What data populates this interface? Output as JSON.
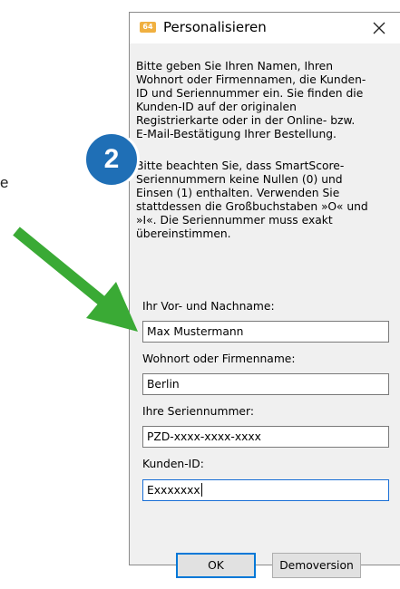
{
  "background_text": "e",
  "dialog": {
    "app_icon_label": "64",
    "title": "Personalisieren",
    "close_symbol": "✕",
    "paragraph1": "Bitte geben Sie Ihren Namen, Ihren\nWohnort oder Firmennamen, die Kunden-\nID und Seriennummer ein. Sie finden die\nKunden-ID auf der originalen\nRegistrierkarte oder in der Online- bzw.\nE-Mail-Bestätigung Ihrer Bestellung.",
    "paragraph2": "Bitte beachten Sie, dass SmartScore-\nSeriennummern keine Nullen (0) und\nEinsen (1) enthalten. Verwenden Sie\nstattdessen die Großbuchstaben »O« und\n»I«. Die Seriennummer muss exakt\nübereinstimmen.",
    "fields": {
      "name_label": "Ihr Vor- und Nachname:",
      "name_value": "Max Mustermann",
      "ort_label": "Wohnort oder Firmenname:",
      "ort_value": "Berlin",
      "serial_label": "Ihre Seriennummer:",
      "serial_value": "PZD-xxxx-xxxx-xxxx",
      "kunden_label": "Kunden-ID:",
      "kunden_value": "Exxxxxxx"
    },
    "buttons": {
      "ok": "OK",
      "demo": "Demoversion"
    }
  },
  "annotation": {
    "step_number": "2",
    "badge_color": "#1f6fb6",
    "arrow_color": "#3aaa35"
  }
}
